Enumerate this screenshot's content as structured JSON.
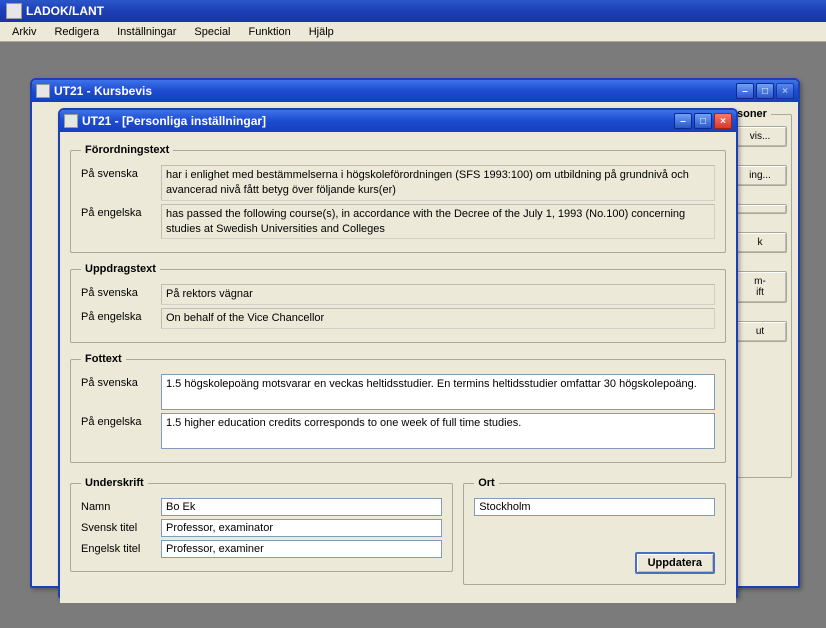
{
  "app": {
    "title": "LADOK/LANT"
  },
  "menu": [
    "Arkiv",
    "Redigera",
    "Inställningar",
    "Special",
    "Funktion",
    "Hjälp"
  ],
  "window_back": {
    "title": "UT21 - Kursbevis",
    "side_buttons": [
      "vis...",
      "ing...",
      "",
      "k",
      "m-\nift",
      "ut"
    ],
    "group_label": "soner"
  },
  "window_front": {
    "title": "UT21 - [Personliga inställningar]",
    "groups": {
      "forord": {
        "legend": "Förordningstext",
        "sv_label": "På svenska",
        "sv_value": "har i enlighet med bestämmelserna i högskoleförordningen (SFS 1993:100) om utbildning på grundnivå och avancerad nivå fått betyg över följande kurs(er)",
        "en_label": "På engelska",
        "en_value": "has passed the following course(s), in accordance with the Decree of the July 1, 1993 (No.100) concerning studies at Swedish Universities and Colleges"
      },
      "uppdrag": {
        "legend": "Uppdragstext",
        "sv_label": "På svenska",
        "sv_value": "På rektors vägnar",
        "en_label": "På engelska",
        "en_value": "On behalf of the Vice Chancellor"
      },
      "fottext": {
        "legend": "Fottext",
        "sv_label": "På svenska",
        "sv_value": "1.5 högskolepoäng motsvarar en veckas heltidsstudier. En termins heltidsstudier omfattar 30 högskolepoäng.",
        "en_label": "På engelska",
        "en_value": "1.5 higher education credits corresponds to one week of full time studies."
      },
      "underskrift": {
        "legend": "Underskrift",
        "name_label": "Namn",
        "name_value": "Bo Ek",
        "svtitle_label": "Svensk titel",
        "svtitle_value": "Professor, examinator",
        "entitle_label": "Engelsk titel",
        "entitle_value": "Professor, examiner"
      },
      "ort": {
        "legend": "Ort",
        "value": "Stockholm"
      }
    },
    "update_button": "Uppdatera"
  }
}
